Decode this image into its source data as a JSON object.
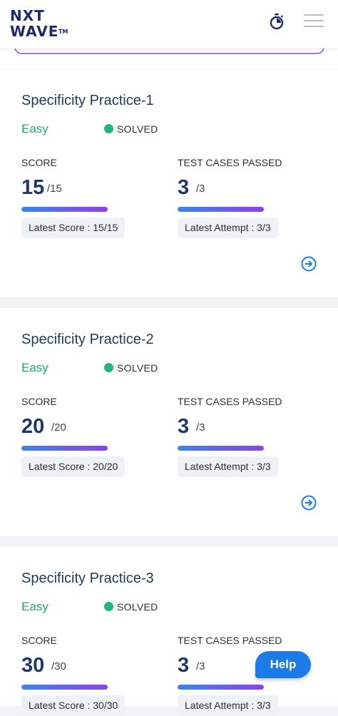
{
  "header": {
    "logo_line1": "NXT",
    "logo_line2": "WAVE",
    "logo_tm": "TM",
    "timer_icon": "stopwatch-icon",
    "menu_icon": "hamburger-menu-icon"
  },
  "labels": {
    "score": "SCORE",
    "test_cases": "TEST CASES PASSED"
  },
  "cards": [
    {
      "title": "Specificity Practice-1",
      "difficulty": "Easy",
      "status": "SOLVED",
      "score": "15",
      "score_total": "/15",
      "tests": "3",
      "tests_total": "/3",
      "latest_score": "Latest Score : 15/15",
      "latest_attempt": "Latest Attempt : 3/3",
      "score_progress": 1,
      "tests_progress": 1
    },
    {
      "title": "Specificity Practice-2",
      "difficulty": "Easy",
      "status": "SOLVED",
      "score": "20",
      "score_total": "/20",
      "tests": "3",
      "tests_total": "/3",
      "latest_score": "Latest Score : 20/20",
      "latest_attempt": "Latest Attempt : 3/3",
      "score_progress": 1,
      "tests_progress": 1
    },
    {
      "title": "Specificity Practice-3",
      "difficulty": "Easy",
      "status": "SOLVED",
      "score": "30",
      "score_total": "/30",
      "tests": "3",
      "tests_total": "/3",
      "latest_score": "Latest Score : 30/30",
      "latest_attempt": "Latest Attempt : 3/3",
      "score_progress": 1,
      "tests_progress": 1
    }
  ],
  "help_button": "Help",
  "colors": {
    "accent": "#1c7be6",
    "easy": "#25a86b",
    "solved_dot": "#1cb87a",
    "title": "#1e3a5f"
  }
}
